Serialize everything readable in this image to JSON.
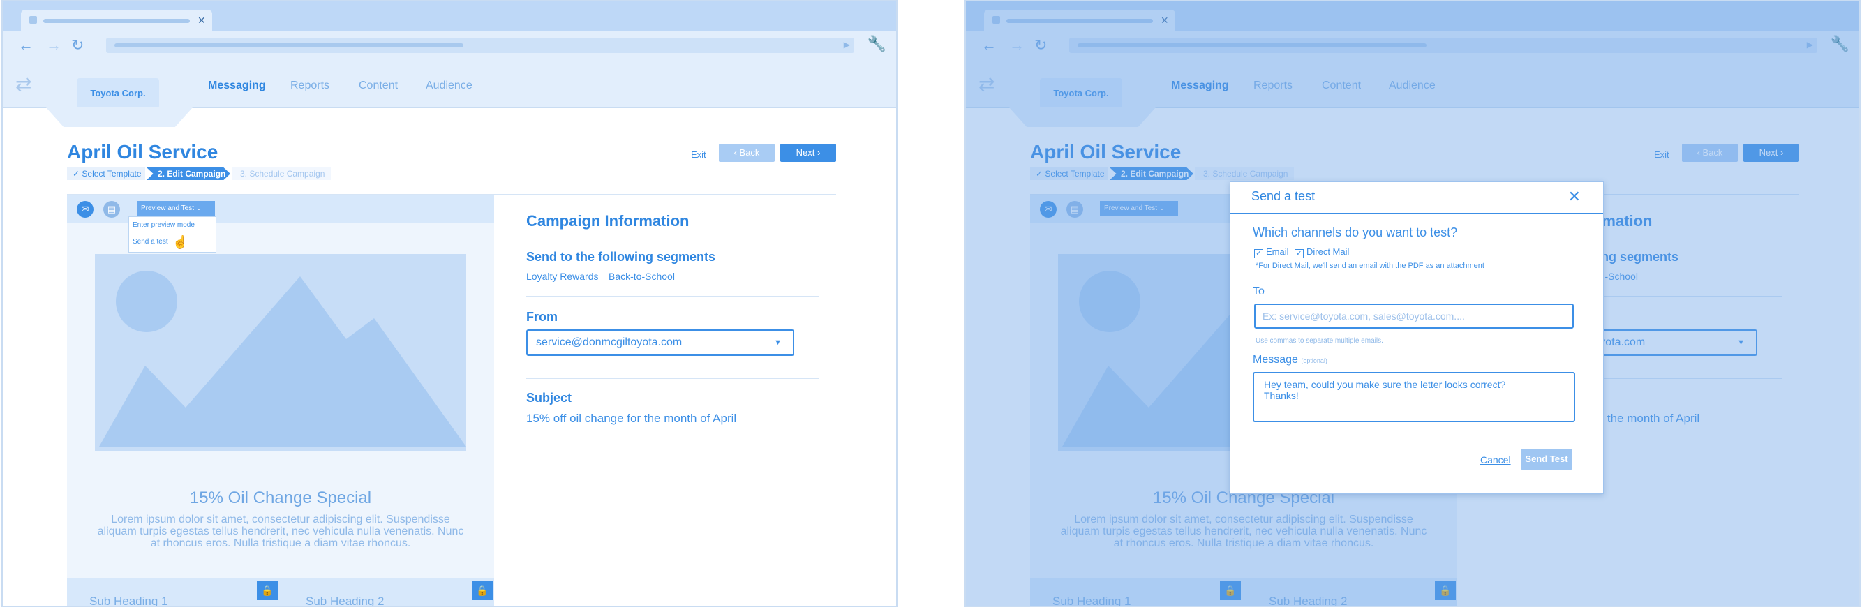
{
  "app": {
    "org": "Toyota Corp.",
    "nav": [
      "Messaging",
      "Reports",
      "Content",
      "Audience"
    ],
    "active_nav": "Messaging"
  },
  "campaign": {
    "title": "April Oil Service",
    "steps": [
      "✓ Select Template",
      "2. Edit Campaign",
      "3. Schedule Campaign"
    ],
    "exit_label": "Exit",
    "back_label": "‹  Back",
    "next_label": "Next  ›"
  },
  "preview": {
    "select_label": "Preview and Test",
    "menu": [
      "Enter preview mode",
      "Send a test"
    ],
    "promo_title": "15% Oil Change Special",
    "promo_body": "Lorem ipsum dolor sit amet, consectetur adipiscing elit. Suspendisse aliquam turpis egestas tellus hendrerit, nec vehicula nulla venenatis. Nunc at rhoncus eros. Nulla tristique a diam vitae rhoncus.",
    "subheadings": [
      "Sub Heading 1",
      "Sub Heading 2"
    ]
  },
  "info": {
    "title": "Campaign Information",
    "segments_heading": "Send to the following segments",
    "segments": [
      "Loyalty Rewards",
      "Back-to-School"
    ],
    "from_heading": "From",
    "from_value": "service@donmcgiltoyota.com",
    "subject_heading": "Subject",
    "subject_value": "15% off oil change for the month of April"
  },
  "modal": {
    "title": "Send a test",
    "question": "Which channels do you want to test?",
    "channels": [
      "Email",
      "Direct Mail"
    ],
    "note": "*For Direct Mail, we'll send an email with the PDF as an attachment",
    "to_label": "To",
    "to_placeholder": "Ex: service@toyota.com, sales@toyota.com....",
    "to_hint": "Use commas to separate multiple emails.",
    "message_label": "Message",
    "message_optional": "(optional)",
    "message_value": "Hey team, could you make sure the letter looks correct?\nThanks!",
    "cancel_label": "Cancel",
    "send_label": "Send Test"
  },
  "icons": {
    "back": "back-arrow-icon",
    "forward": "forward-arrow-icon",
    "reload": "reload-icon",
    "wrench": "wrench-icon",
    "shuffle": "shuffle-icon",
    "email": "email-icon",
    "pdf": "pdf-icon",
    "lock": "lock-icon",
    "close": "close-icon"
  },
  "colors": {
    "accent": "#3c8fe6",
    "chrome": "#bed8f7",
    "overlay": "#6ea5e8"
  }
}
